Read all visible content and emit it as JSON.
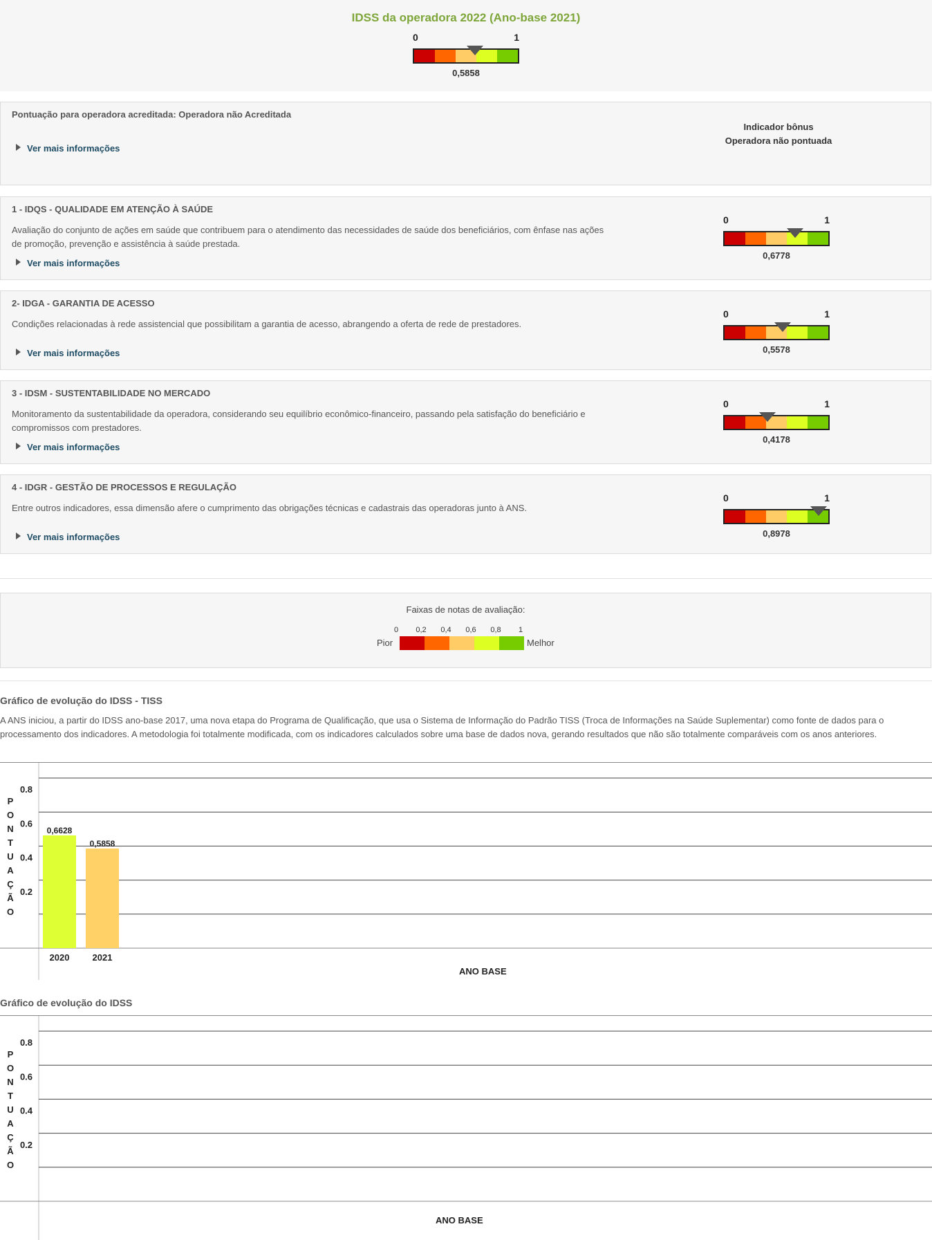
{
  "colors": {
    "scale": [
      "#cc0000",
      "#ff6600",
      "#ffcc66",
      "#ddff22",
      "#77cc00"
    ],
    "title_green": "#7ea63a",
    "link": "#1f4d66"
  },
  "gauge_labels": {
    "min": "0",
    "max": "1"
  },
  "header": {
    "title": "IDSS da operadora 2022 (Ano-base 2021)",
    "value": 0.5858,
    "value_label": "0,5858"
  },
  "accredited": {
    "title": "Pontuação para operadora acreditada: Operadora não Acreditada",
    "more_label": "Ver mais informações",
    "bonus_line1": "Indicador bônus",
    "bonus_line2": "Operadora não pontuada"
  },
  "dimensions": [
    {
      "title": "1 - IDQS - QUALIDADE EM ATENÇÃO À SAÚDE",
      "description": "Avaliação do conjunto de ações em saúde que contribuem para o atendimento das necessidades de saúde dos beneficiários, com ênfase nas ações de promoção, prevenção e assistência à saúde prestada.",
      "more_label": "Ver mais informações",
      "value": 0.6778,
      "value_label": "0,6778"
    },
    {
      "title": "2- IDGA - GARANTIA DE ACESSO",
      "description": "Condições relacionadas à rede assistencial que possibilitam a garantia de acesso, abrangendo a oferta de rede de prestadores.",
      "more_label": "Ver mais informações",
      "value": 0.5578,
      "value_label": "0,5578"
    },
    {
      "title": "3 - IDSM - SUSTENTABILIDADE NO MERCADO",
      "description": "Monitoramento da sustentabilidade da operadora, considerando seu equilíbrio econômico-financeiro, passando pela satisfação do beneficiário e compromissos com prestadores.",
      "more_label": "Ver mais informações",
      "value": 0.4178,
      "value_label": "0,4178"
    },
    {
      "title": "4 - IDGR - GESTÃO DE PROCESSOS E REGULAÇÃO",
      "description": "Entre outros indicadores, essa dimensão afere o cumprimento das obrigações técnicas e cadastrais das operadoras junto à ANS.",
      "more_label": "Ver mais informações",
      "value": 0.8978,
      "value_label": "0,8978"
    }
  ],
  "legend": {
    "title": "Faixas de notas de avaliação:",
    "ticks": [
      "0",
      "0,2",
      "0,4",
      "0,6",
      "0,8",
      "1"
    ],
    "worse": "Pior",
    "better": "Melhor"
  },
  "tiss_section": {
    "title": "Gráfico de evolução do IDSS - TISS",
    "description": "A ANS iniciou, a partir do IDSS ano-base 2017, uma nova etapa do Programa de Qualificação, que usa o Sistema de Informação do Padrão TISS (Troca de Informações na Saúde Suplementar) como fonte de dados para o processamento dos indicadores. A metodologia foi totalmente modificada, com os indicadores calculados sobre uma base de dados nova, gerando resultados que não são totalmente comparáveis com os anos anteriores."
  },
  "idss_section": {
    "title": "Gráfico de evolução do IDSS"
  },
  "chart_data": [
    {
      "type": "bar",
      "categories": [
        "2020",
        "2021"
      ],
      "values": [
        0.6628,
        0.5858
      ],
      "value_labels": [
        "0,6628",
        "0,5858"
      ],
      "bar_colors": [
        "#ddff33",
        "#ffd166"
      ],
      "ylabel": "PONTUAÇÃO",
      "xlabel": "ANO BASE",
      "yticks": [
        "0.2",
        "0.4",
        "0.6",
        "0.8",
        "1.0"
      ],
      "ylim": [
        0,
        1.0
      ],
      "grid": true
    },
    {
      "type": "bar",
      "categories": [],
      "values": [],
      "ylabel": "PONTUAÇÃO",
      "xlabel": "ANO BASE",
      "yticks": [
        "0.2",
        "0.4",
        "0.6",
        "0.8",
        "1.0"
      ],
      "ylim": [
        0,
        1.0
      ],
      "grid": true
    }
  ]
}
